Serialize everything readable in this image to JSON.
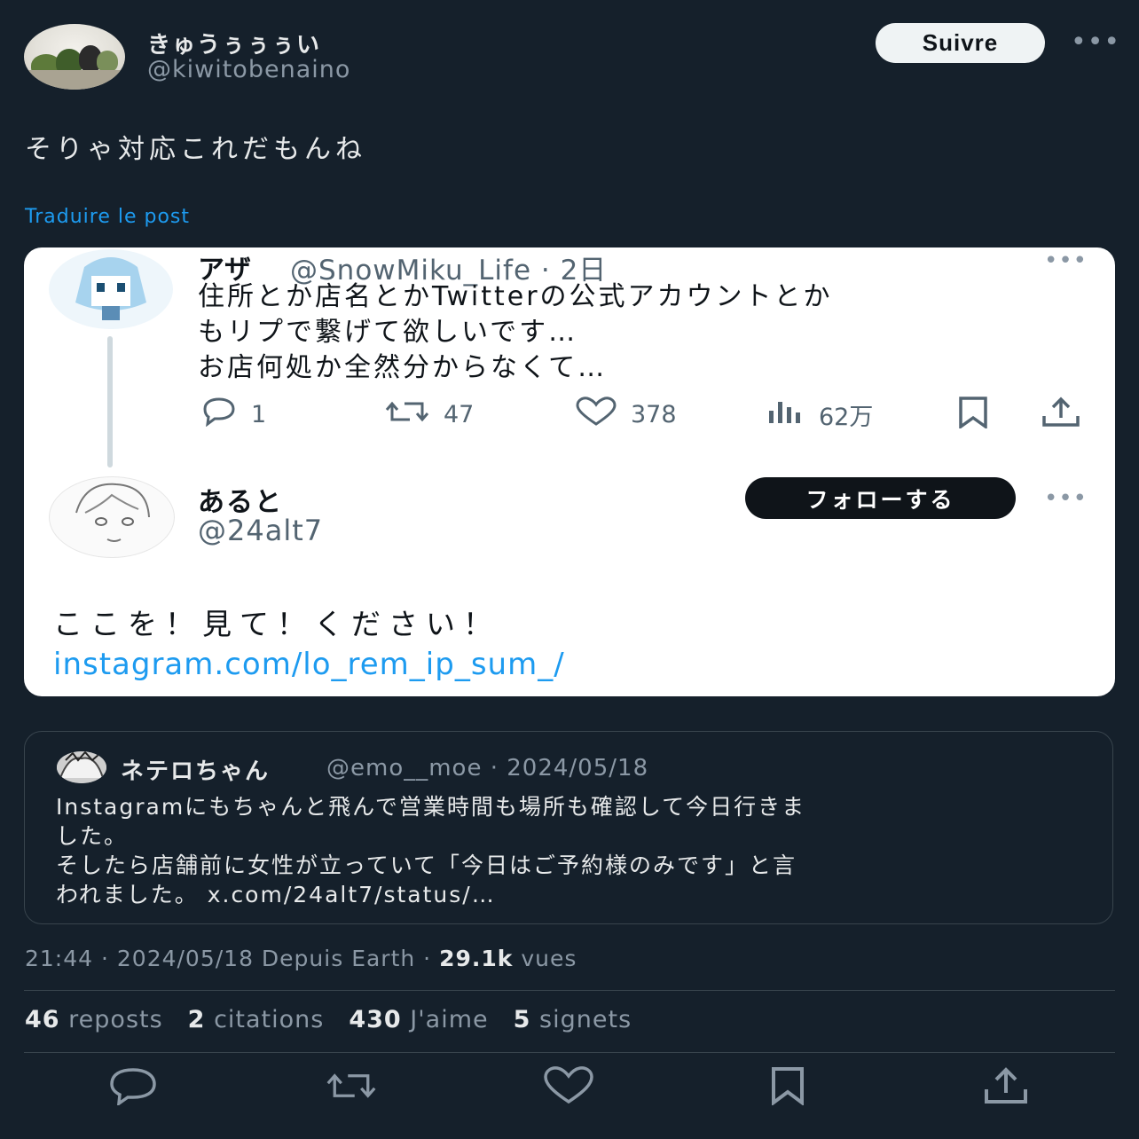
{
  "author": {
    "display_name": "きゅうぅぅぅい",
    "handle": "@kiwitobenaino",
    "follow_label": "Suivre",
    "more": "•••"
  },
  "tweet": {
    "text": "そりゃ対応これだもんね",
    "translate_label": "Traduire le post"
  },
  "screenshot": {
    "post1": {
      "name": "アザ",
      "handle_time": "@SnowMiku_Life · 2日",
      "lines": [
        "住所とか店名とかTwitterの公式アカウントとか",
        "もリプで繋げて欲しいです…",
        "お店何処か全然分からなくて…"
      ],
      "replies": "1",
      "reposts": "47",
      "likes": "378",
      "views": "62万"
    },
    "post2": {
      "name": "あると",
      "handle": "@24alt7",
      "follow_label": "フォローする",
      "text": "ここを！見て！ください！",
      "link": "instagram.com/lo_rem_ip_sum_/"
    },
    "more": "•••"
  },
  "quote": {
    "name": "ネテロちゃん",
    "handle_date": "@emo__moe · 2024/05/18",
    "lines": [
      "Instagramにもちゃんと飛んで営業時間も場所も確認して今日行きま",
      "した。",
      "そしたら店舗前に女性が立っていて「今日はご予約様のみです」と言",
      "われました。 x.com/24alt7/status/…"
    ]
  },
  "meta": {
    "time_date_source": "21:44 · 2024/05/18 Depuis Earth · ",
    "views_count": "29.1k",
    "views_label": " vues"
  },
  "stats": {
    "reposts_count": "46",
    "reposts_label": "reposts",
    "quotes_count": "2",
    "quotes_label": "citations",
    "likes_count": "430",
    "likes_label": "J'aime",
    "bookmarks_count": "5",
    "bookmarks_label": "signets"
  },
  "colors": {
    "background": "#15202b",
    "link": "#1d9bf0",
    "secondary_text": "#8b98a5"
  }
}
